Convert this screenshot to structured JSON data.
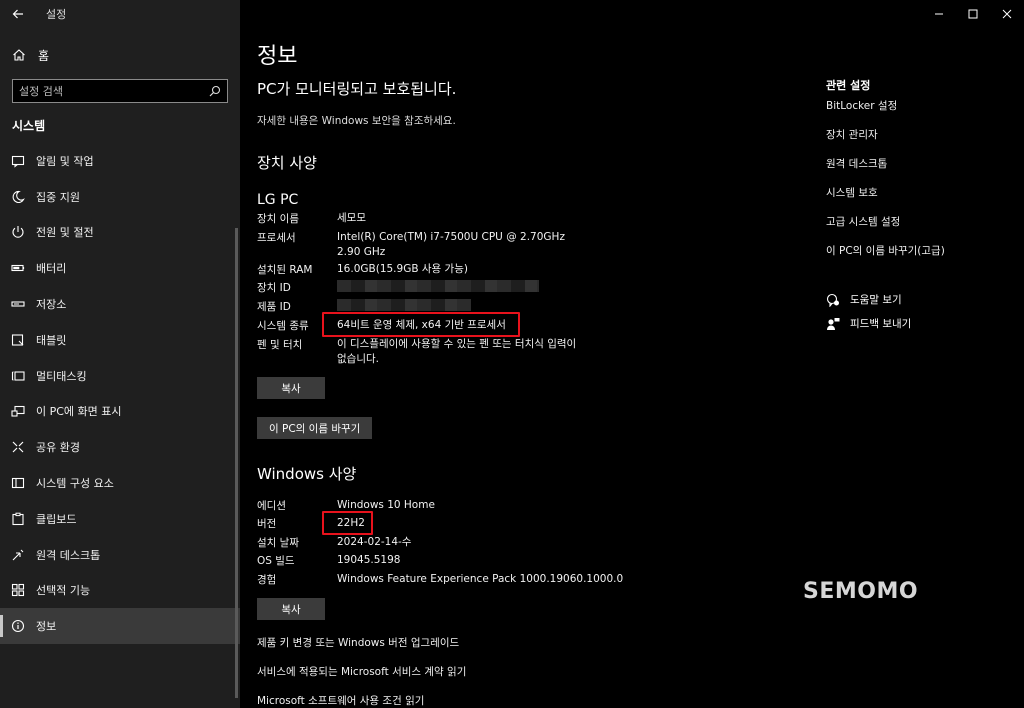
{
  "window": {
    "title": "설정"
  },
  "sidebar": {
    "home_label": "홈",
    "search_placeholder": "설정 검색",
    "section_label": "시스템",
    "items": [
      {
        "label": "알림 및 작업",
        "icon": "notification-icon"
      },
      {
        "label": "집중 지원",
        "icon": "moon-icon"
      },
      {
        "label": "전원 및 절전",
        "icon": "power-icon"
      },
      {
        "label": "배터리",
        "icon": "battery-icon"
      },
      {
        "label": "저장소",
        "icon": "storage-icon"
      },
      {
        "label": "태블릿",
        "icon": "tablet-icon"
      },
      {
        "label": "멀티태스킹",
        "icon": "multitasking-icon"
      },
      {
        "label": "이 PC에 화면 표시",
        "icon": "project-icon"
      },
      {
        "label": "공유 환경",
        "icon": "share-icon"
      },
      {
        "label": "시스템 구성 요소",
        "icon": "components-icon"
      },
      {
        "label": "클립보드",
        "icon": "clipboard-icon"
      },
      {
        "label": "원격 데스크톱",
        "icon": "remote-desktop-icon"
      },
      {
        "label": "선택적 기능",
        "icon": "optional-features-icon"
      },
      {
        "label": "정보",
        "icon": "info-icon"
      }
    ]
  },
  "main": {
    "title": "정보",
    "protection_status": "PC가 모니터링되고 보호됩니다.",
    "security_note": "자세한 내용은 Windows 보안을 참조하세요.",
    "device_specs": {
      "heading": "장치 사양",
      "device_name_title": "LG PC",
      "rows": [
        {
          "key": "장치 이름",
          "value": "세모모"
        },
        {
          "key": "프로세서",
          "value": "Intel(R) Core(TM) i7-7500U CPU @ 2.70GHz   2.90 GHz"
        },
        {
          "key": "설치된 RAM",
          "value": "16.0GB(15.9GB 사용 가능)"
        },
        {
          "key": "장치 ID",
          "value": ""
        },
        {
          "key": "제품 ID",
          "value": ""
        },
        {
          "key": "시스템 종류",
          "value": "64비트 운영 체제, x64 기반 프로세서"
        },
        {
          "key": "펜 및 터치",
          "value": "이 디스플레이에 사용할 수 있는 펜 또는 터치식 입력이 없습니다."
        }
      ],
      "copy_button": "복사",
      "rename_button": "이 PC의 이름 바꾸기"
    },
    "windows_specs": {
      "heading": "Windows 사양",
      "rows": [
        {
          "key": "에디션",
          "value": "Windows 10 Home"
        },
        {
          "key": "버전",
          "value": "22H2"
        },
        {
          "key": "설치 날짜",
          "value": "2024-02-14-수"
        },
        {
          "key": "OS 빌드",
          "value": "19045.5198"
        },
        {
          "key": "경험",
          "value": "Windows Feature Experience Pack 1000.19060.1000.0"
        }
      ],
      "copy_button": "복사"
    },
    "links": [
      "제품 키 변경 또는 Windows 버전 업그레이드",
      "서비스에 적용되는 Microsoft 서비스 계약 읽기",
      "Microsoft 소프트웨어 사용 조건 읽기"
    ]
  },
  "related": {
    "title": "관련 설정",
    "items": [
      "BitLocker 설정",
      "장치 관리자",
      "원격 데스크톱",
      "시스템 보호",
      "고급 시스템 설정",
      "이 PC의 이름 바꾸기(고급)"
    ],
    "help_label": "도움말 보기",
    "feedback_label": "피드백 보내기"
  },
  "watermark": "SEMOMO",
  "colors": {
    "highlight": "#e8121c",
    "sidebar_bg": "#1f1f1f",
    "button_bg": "#3b3b3b"
  }
}
